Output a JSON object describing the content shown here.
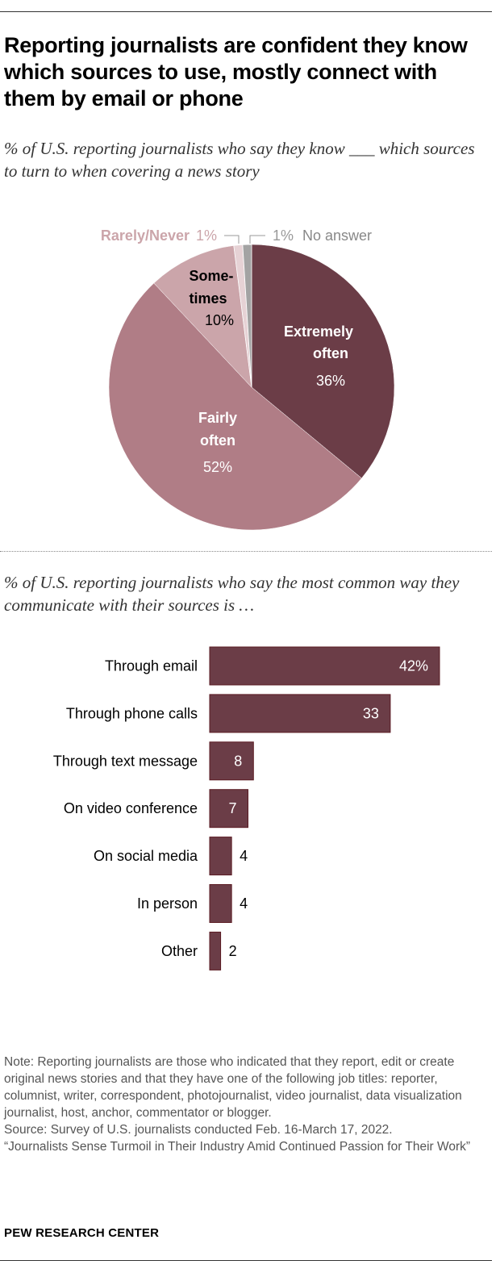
{
  "title": "Reporting journalists are confident they know which sources to use, mostly connect with them by email or phone",
  "subtitle1": "% of U.S. reporting journalists who say they know ___ which sources to turn to when covering a news story",
  "subtitle2": "% of U.S. reporting journalists who say the most common way they communicate with their sources is …",
  "chart_data": [
    {
      "type": "pie",
      "slices": [
        {
          "label": "Extremely often",
          "value": 36,
          "value_label": "36%",
          "color": "#6b3d47"
        },
        {
          "label": "Fairly often",
          "value": 52,
          "value_label": "52%",
          "color": "#b07d86"
        },
        {
          "label": "Some-times",
          "value": 10,
          "value_label": "10%",
          "color": "#cba5aa"
        },
        {
          "label": "Rarely/Never",
          "value": 1,
          "value_label": "1%",
          "color": "#e6d2d5"
        },
        {
          "label": "No answer",
          "value": 1,
          "value_label": "1%",
          "color": "#a3a3a3"
        }
      ]
    },
    {
      "type": "bar",
      "orientation": "horizontal",
      "categories": [
        "Through email",
        "Through phone calls",
        "Through text message",
        "On video conference",
        "On social media",
        "In person",
        "Other"
      ],
      "values": [
        42,
        33,
        8,
        7,
        4,
        4,
        2
      ],
      "value_labels": [
        "42%",
        "33",
        "8",
        "7",
        "4",
        "4",
        "2"
      ],
      "color": "#6b3d47"
    }
  ],
  "notes": {
    "note": "Note: Reporting journalists are those who indicated that they report, edit or create original news stories and that they have one of the following job titles: reporter, columnist, writer, correspondent, photojournalist, video journalist, data visualization journalist, host, anchor, commentator or blogger.",
    "source": "Source: Survey of U.S. journalists conducted Feb. 16-March 17, 2022.",
    "report": "“Journalists Sense Turmoil in Their Industry Amid Continued Passion for Their Work”"
  },
  "brand": "PEW RESEARCH CENTER"
}
